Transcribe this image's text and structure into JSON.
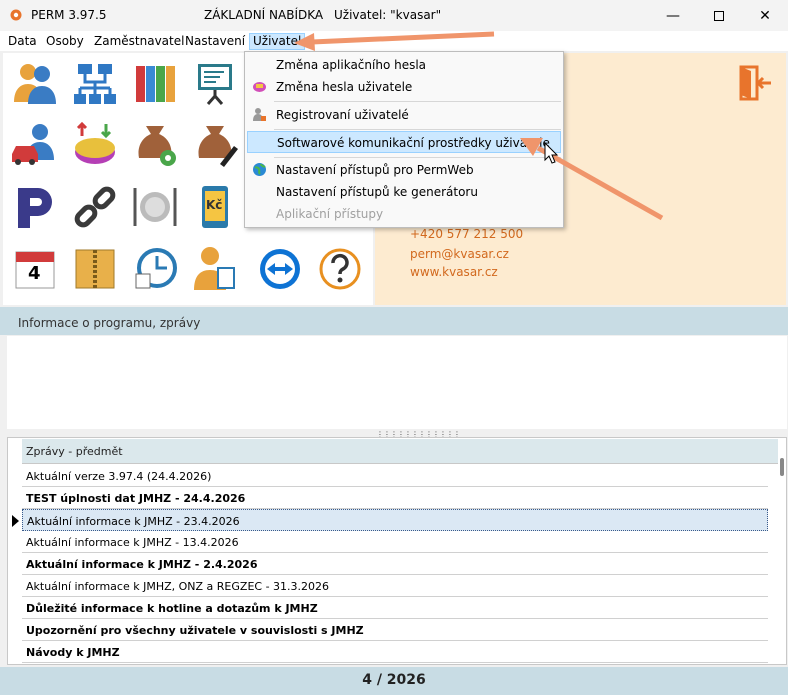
{
  "window": {
    "app_title": "PERM 3.97.5",
    "main_title": "ZÁKLADNÍ NABÍDKA",
    "user_title": "Uživatel: \"kvasar\"",
    "minimize_icon": "minimize-icon",
    "maximize_icon": "maximize-icon",
    "close_icon": "close-icon"
  },
  "menubar": {
    "items": [
      "Data",
      "Osoby",
      "Zaměstnavatel",
      "Nastavení",
      "Uživatel"
    ]
  },
  "dropdown": {
    "items": [
      {
        "label": "Změna aplikačního hesla",
        "icon": "none",
        "enabled": true
      },
      {
        "label": "Změna hesla uživatele",
        "icon": "password-icon",
        "enabled": true
      },
      {
        "label": "Registrovaní uživatelé",
        "icon": "users-lock-icon",
        "enabled": true
      },
      {
        "label": "Softwarové komunikační prostředky uživatele",
        "icon": "none",
        "enabled": true,
        "highlighted": true
      },
      {
        "label": "Nastavení přístupů pro PermWeb",
        "icon": "globe-icon",
        "enabled": true
      },
      {
        "label": "Nastavení přístupů ke generátoru",
        "icon": "none",
        "enabled": true
      },
      {
        "label": "Aplikační přístupy",
        "icon": "none",
        "enabled": false
      }
    ]
  },
  "icon_panel": {
    "icons": [
      "persons-icon",
      "org-structure-icon",
      "binders-icon",
      "presentation-icon",
      "person-car-icon",
      "transfer-icon",
      "money-bag-gear-icon",
      "money-bag-pen-icon",
      "perm-logo-icon",
      "chain-icon",
      "plate-cutlery-icon",
      "tablet-kc-icon",
      "calendar-icon",
      "zipper-box-icon",
      "clock-calendar-icon",
      "person-document-icon",
      "teamviewer-icon",
      "help-icon"
    ],
    "calendar_day": "4",
    "tablet_text": "Kč"
  },
  "info_panel": {
    "phone": "+420 577 212 500",
    "email": "perm@kvasar.cz",
    "web": "www.kvasar.cz",
    "door_icon": "exit-door-icon"
  },
  "info_section": {
    "header": "Informace o programu, zprávy"
  },
  "messages": {
    "column_header": "Zprávy - předmět",
    "rows": [
      {
        "subject": "Aktuální verze 3.97.4 (24.4.2026)",
        "bold": false
      },
      {
        "subject": "TEST úplnosti dat JMHZ - 24.4.2026",
        "bold": true
      },
      {
        "subject": "Aktuální informace k JMHZ - 23.4.2026",
        "bold": false,
        "selected": true
      },
      {
        "subject": "Aktuální informace k JMHZ - 13.4.2026",
        "bold": false
      },
      {
        "subject": "Aktuální informace k JMHZ - 2.4.2026",
        "bold": true
      },
      {
        "subject": "Aktuální informace k JMHZ, ONZ a REGZEC - 31.3.2026",
        "bold": false
      },
      {
        "subject": "Důležité informace k hotline a dotazům k JMHZ",
        "bold": true
      },
      {
        "subject": "Upozornění pro všechny uživatele v souvislosti s JMHZ",
        "bold": true
      },
      {
        "subject": "Návody k JMHZ",
        "bold": true
      }
    ]
  },
  "status": {
    "period": "4 / 2026"
  },
  "colors": {
    "accent": "#f0956b",
    "info_bg": "#fdebd0",
    "contact_text": "#d2691e",
    "section_bg": "#c8dce4"
  }
}
